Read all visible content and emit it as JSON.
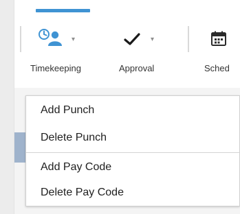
{
  "toolbar": {
    "items": [
      {
        "label": "Timekeeping",
        "icon": "timekeeping-icon",
        "active": true
      },
      {
        "label": "Approval",
        "icon": "checkmark-icon",
        "active": false
      },
      {
        "label": "Sched",
        "icon": "calendar-icon",
        "active": false
      }
    ],
    "accent_color": "#3f93d3"
  },
  "dropdown_menu": {
    "items": [
      {
        "label": "Add Punch"
      },
      {
        "label": "Delete Punch"
      },
      {
        "label": "Add Pay Code"
      },
      {
        "label": "Delete Pay Code"
      }
    ]
  }
}
